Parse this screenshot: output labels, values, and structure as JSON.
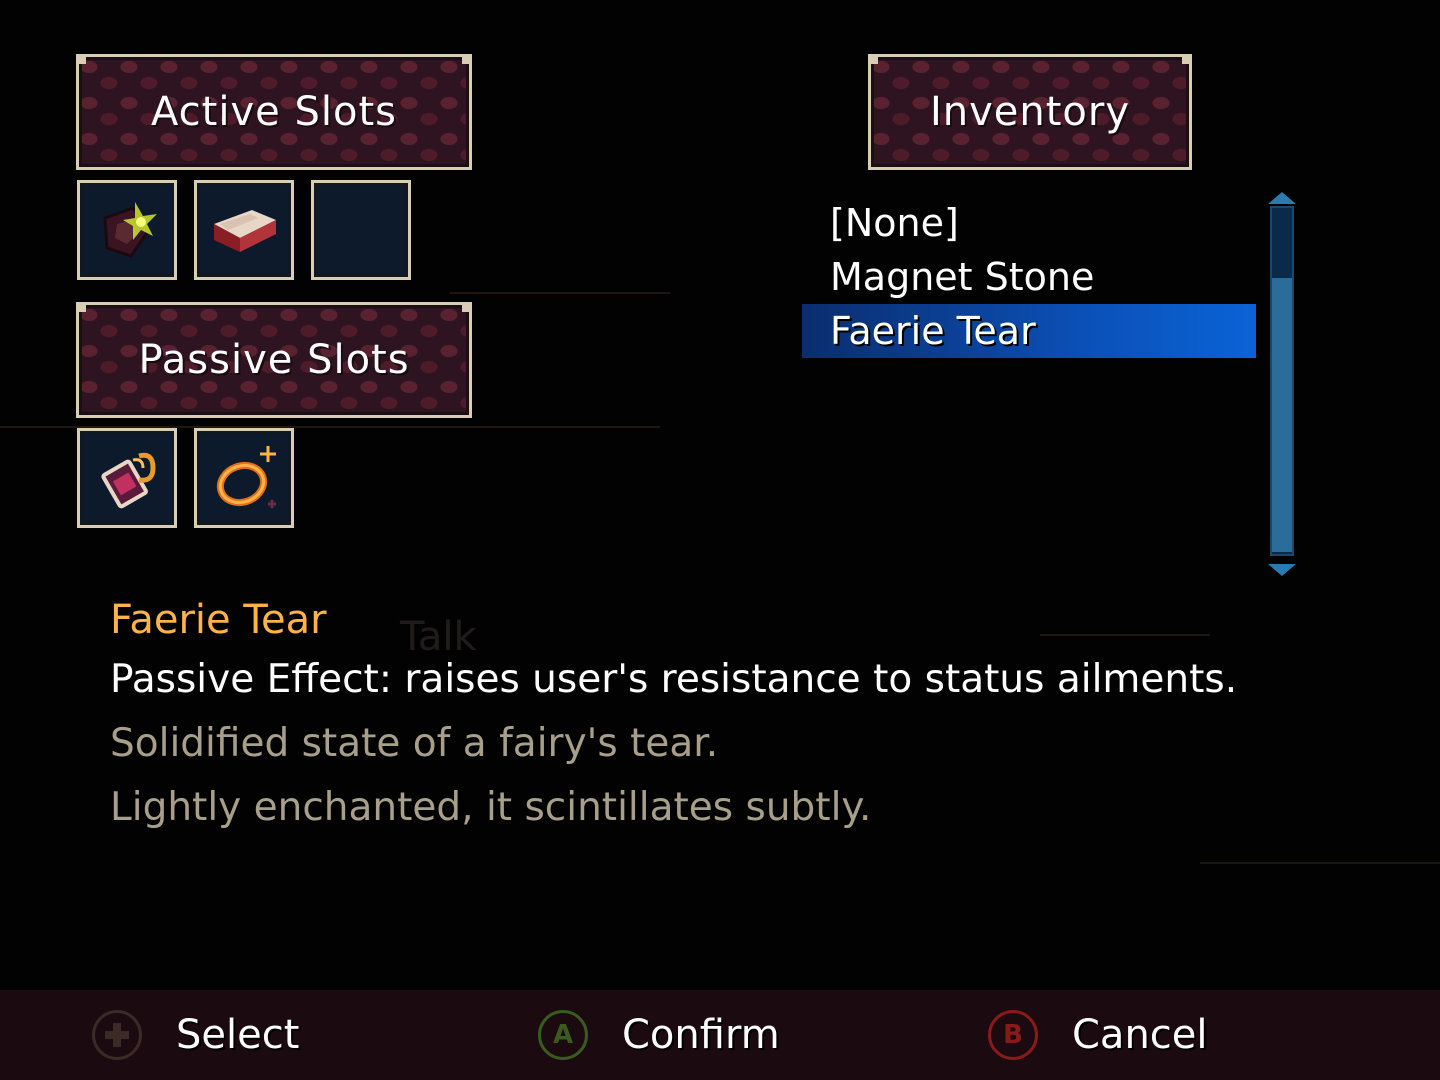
{
  "headers": {
    "active": "Active Slots",
    "passive": "Passive Slots",
    "inventory": "Inventory"
  },
  "active_slots": [
    {
      "item": "explosive-charm-icon",
      "filled": true
    },
    {
      "item": "scroll-card-icon",
      "filled": true
    },
    {
      "item": "",
      "filled": false
    }
  ],
  "passive_slots": [
    {
      "item": "magnet-stone-icon",
      "filled": true
    },
    {
      "item": "faerie-tear-ring-icon",
      "filled": true
    }
  ],
  "inventory": {
    "items": [
      "[None]",
      "Magnet Stone",
      "Faerie Tear"
    ],
    "selected_index": 2
  },
  "description": {
    "title": "Faerie Tear",
    "effect": "Passive Effect: raises user's resistance to status ailments.",
    "flavor_1": "Solidified state of a fairy's tear.",
    "flavor_2": "Lightly enchanted, it scintillates subtly."
  },
  "background_prompt": "Talk",
  "footer": {
    "select": "Select",
    "confirm": "Confirm",
    "cancel": "Cancel",
    "confirm_button_glyph": "A",
    "cancel_button_glyph": "B"
  },
  "colors": {
    "accent_title": "#ffb347",
    "selection": "#0b4fb5",
    "header_border": "#d9cdb3",
    "confirm_button": "#3a5a1e",
    "cancel_button": "#8a1a1a"
  }
}
